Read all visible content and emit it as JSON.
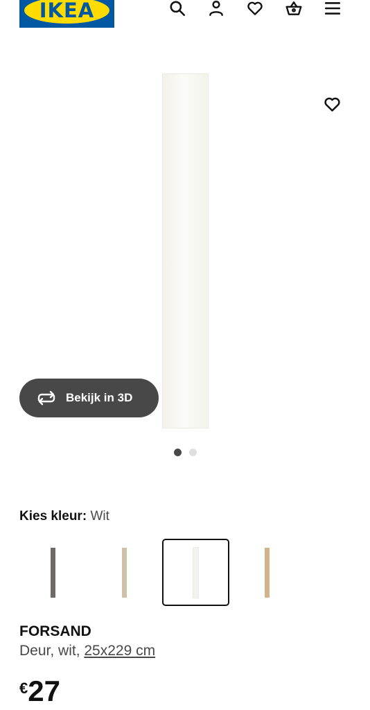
{
  "header": {
    "logo_text": "IKEA",
    "icons": [
      "search-icon",
      "user-icon",
      "heart-icon",
      "basket-icon",
      "menu-icon"
    ]
  },
  "gallery": {
    "view_3d_label": "Bekijk in 3D",
    "total_images": 2,
    "active_image": 1
  },
  "color_picker": {
    "label": "Kies kleur:",
    "selected_value": "Wit",
    "swatches": [
      {
        "color": "#6f6a66",
        "selected": false
      },
      {
        "color": "#cfc0a8",
        "selected": false
      },
      {
        "color": "#f3f3ed",
        "selected": true
      },
      {
        "color": "#d3b38e",
        "selected": false
      }
    ]
  },
  "product": {
    "name": "FORSAND",
    "description": "Deur, wit,",
    "dimensions": "25x229 cm",
    "currency": "€",
    "price": "27"
  },
  "colors": {
    "brand_blue": "#0058a3",
    "brand_yellow": "#ffdb00",
    "dark_button": "#484848"
  }
}
